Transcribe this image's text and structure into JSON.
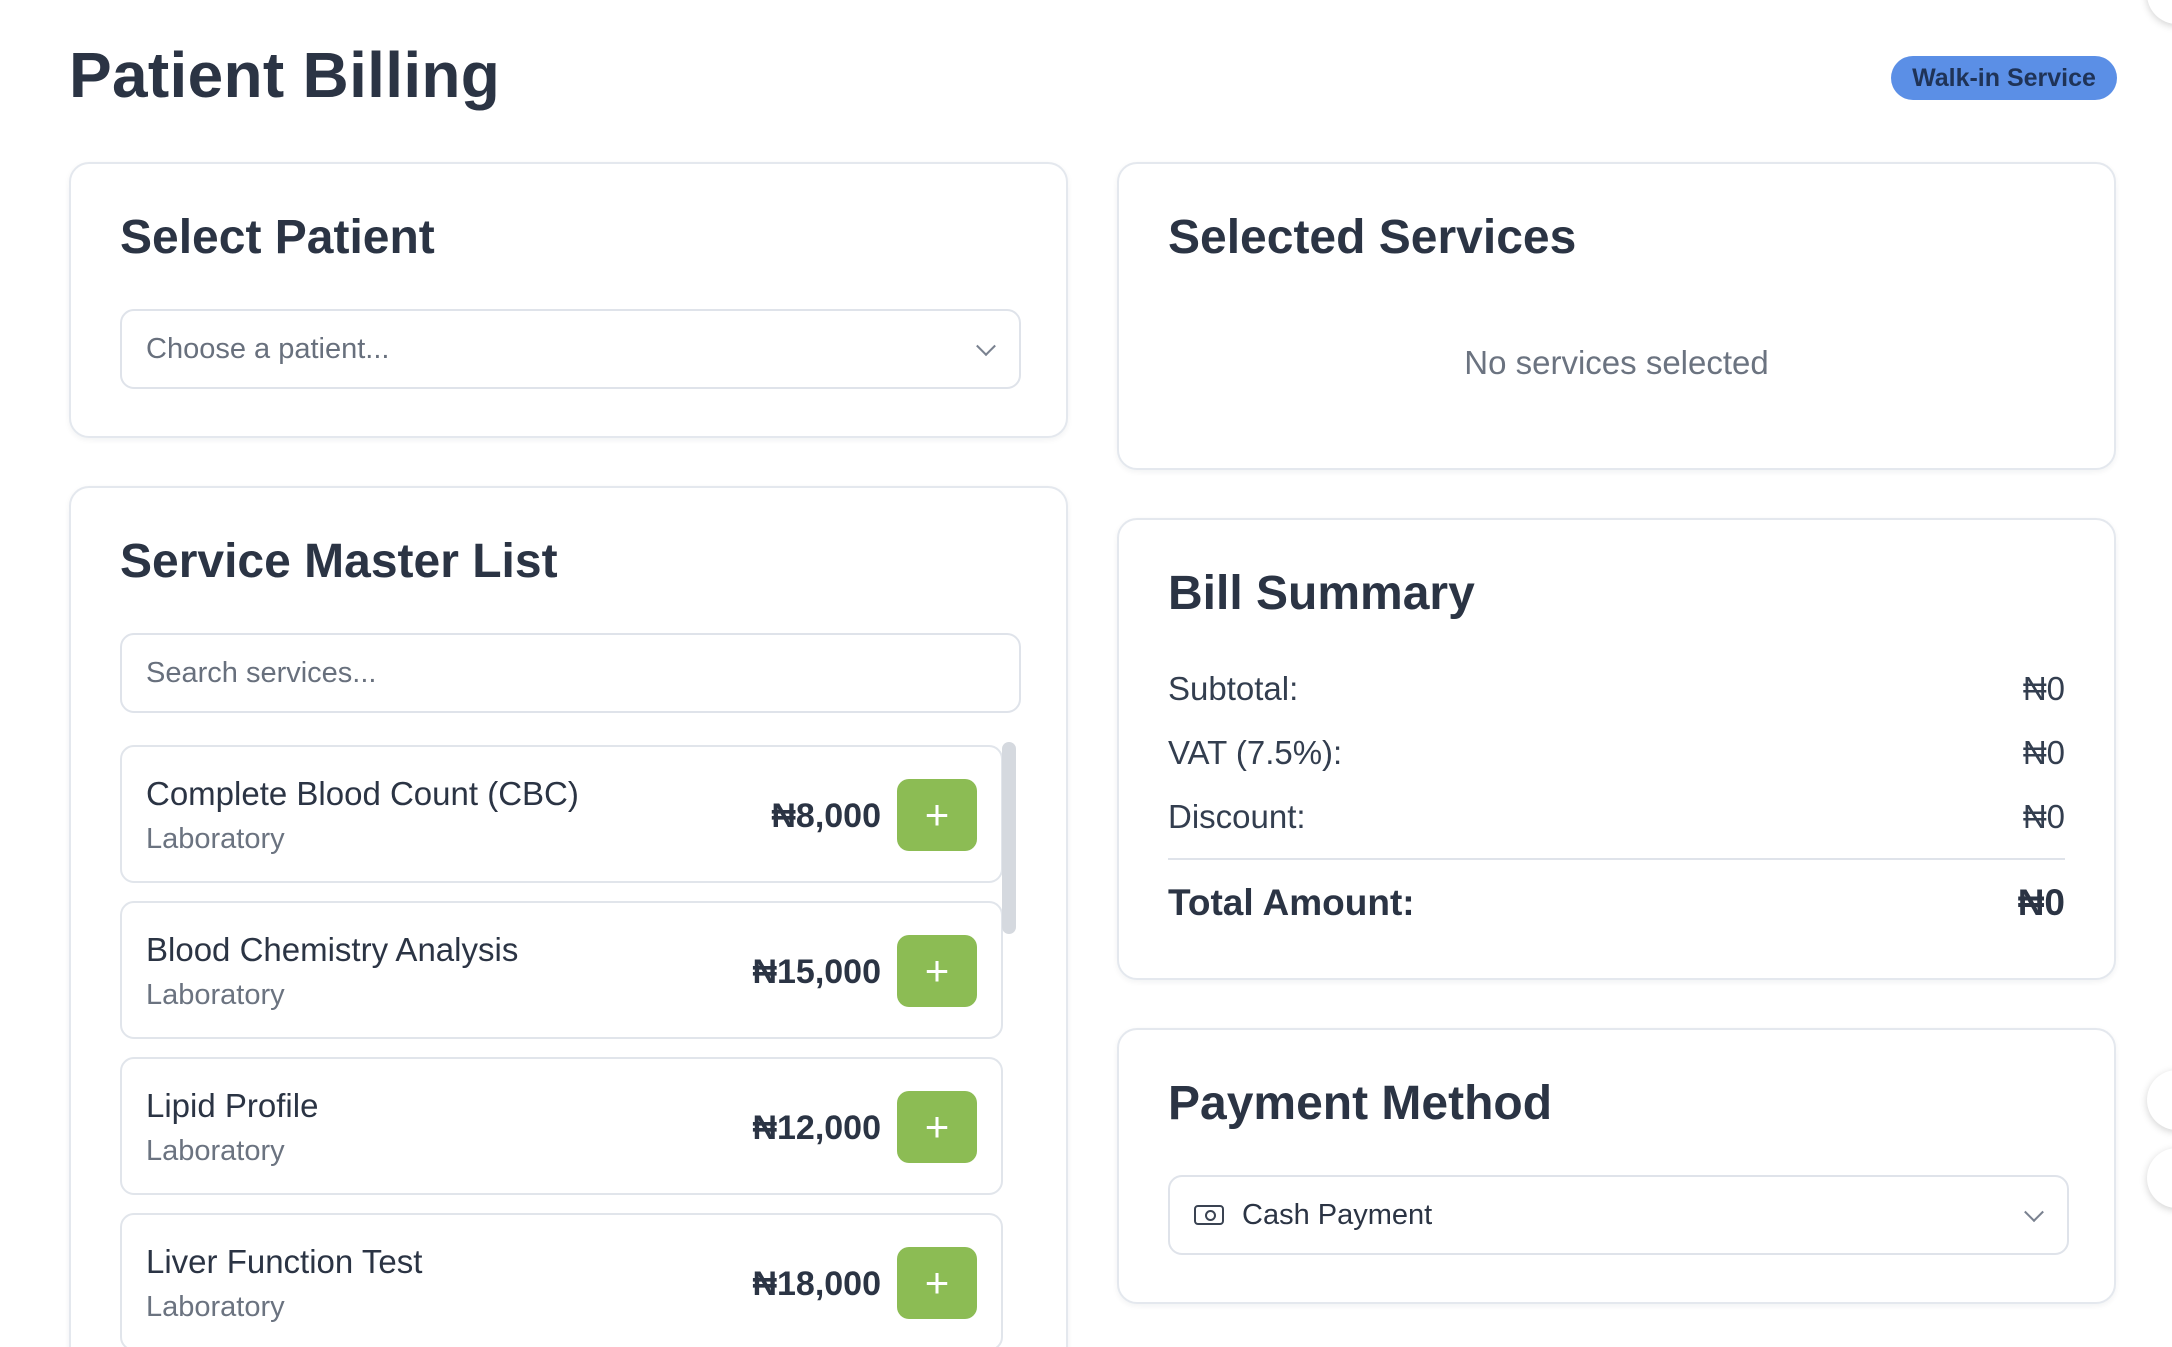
{
  "header": {
    "title": "Patient Billing",
    "badge": "Walk-in Service"
  },
  "select_patient": {
    "title": "Select Patient",
    "placeholder": "Choose a patient..."
  },
  "service_master": {
    "title": "Service Master List",
    "search_placeholder": "Search services...",
    "add_symbol": "+",
    "items": [
      {
        "name": "Complete Blood Count (CBC)",
        "category": "Laboratory",
        "price": "₦8,000"
      },
      {
        "name": "Blood Chemistry Analysis",
        "category": "Laboratory",
        "price": "₦15,000"
      },
      {
        "name": "Lipid Profile",
        "category": "Laboratory",
        "price": "₦12,000"
      },
      {
        "name": "Liver Function Test",
        "category": "Laboratory",
        "price": "₦18,000"
      }
    ]
  },
  "selected_services": {
    "title": "Selected Services",
    "empty_text": "No services selected"
  },
  "bill_summary": {
    "title": "Bill Summary",
    "subtotal_label": "Subtotal:",
    "subtotal_value": "₦0",
    "vat_label": "VAT (7.5%):",
    "vat_value": "₦0",
    "discount_label": "Discount:",
    "discount_value": "₦0",
    "total_label": "Total Amount:",
    "total_value": "₦0"
  },
  "payment_method": {
    "title": "Payment Method",
    "selected": "Cash Payment",
    "icon": "cash-icon"
  },
  "colors": {
    "accent_badge": "#5b8fe6",
    "add_button": "#8cbc54",
    "heading": "#2b3444"
  }
}
